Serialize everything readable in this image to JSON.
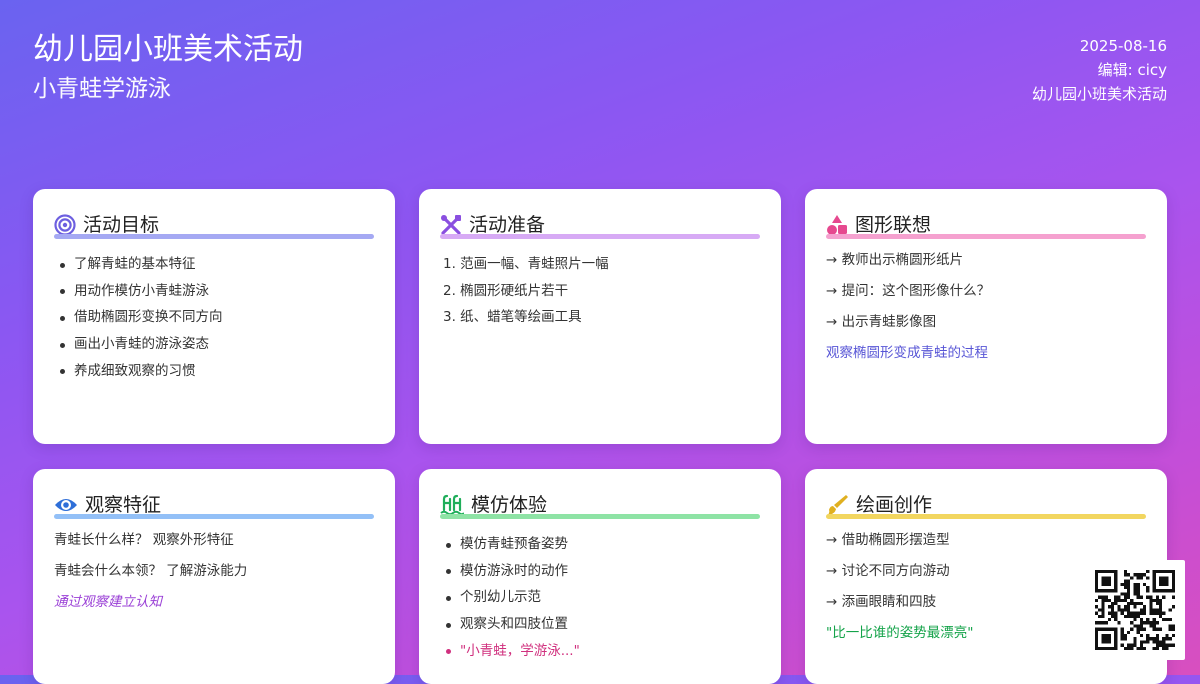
{
  "header": {
    "title": "幼儿园小班美术活动",
    "subtitle": "小青蛙学游泳",
    "date": "2025-08-16",
    "editor": "编辑: cicy",
    "category": "幼儿园小班美术活动"
  },
  "theme": {
    "background_start": "#6a63f0",
    "background_end": "#d84fbf"
  },
  "cards": {
    "goals": {
      "title": "活动目标",
      "icon": "target-icon",
      "accent": "#a5a9f3",
      "items": [
        "了解青蛙的基本特征",
        "用动作模仿小青蛙游泳",
        "借助椭圆形变换不同方向",
        "画出小青蛙的游泳姿态",
        "养成细致观察的习惯"
      ]
    },
    "preparation": {
      "title": "活动准备",
      "icon": "tools-icon",
      "accent": "#d7aaf5",
      "items": [
        "1. 范画一幅、青蛙照片一幅",
        "2. 椭圆形硬纸片若干",
        "3. 纸、蜡笔等绘画工具"
      ]
    },
    "shape_association": {
      "title": "图形联想",
      "icon": "shapes-icon",
      "accent": "#f5a1cf",
      "items": [
        "→ 教师出示椭圆形纸片",
        "→ 提问：这个图形像什么？",
        "→ 出示青蛙影像图"
      ],
      "note": "观察椭圆形变成青蛙的过程"
    },
    "observation": {
      "title": "观察特征",
      "icon": "eye-icon",
      "accent": "#93c0f7",
      "items": [
        "青蛙长什么样？ 观察外形特征",
        "青蛙会什么本领？ 了解游泳能力"
      ],
      "note": "通过观察建立认知"
    },
    "imitation": {
      "title": "模仿体验",
      "icon": "swimmer-icon",
      "accent": "#8ee3a5",
      "items": [
        "模仿青蛙预备姿势",
        "模仿游泳时的动作",
        "个别幼儿示范",
        "观察头和四肢位置"
      ],
      "chant": "\"小青蛙，学游泳...\""
    },
    "painting": {
      "title": "绘画创作",
      "icon": "paintbrush-icon",
      "accent": "#f2d660",
      "items": [
        "→ 借助椭圆形摆造型",
        "→ 讨论不同方向游动",
        "→ 添画眼睛和四肢"
      ],
      "note": "\"比一比谁的姿势最漂亮\""
    }
  },
  "qr": {
    "icon": "qr-code-icon"
  }
}
